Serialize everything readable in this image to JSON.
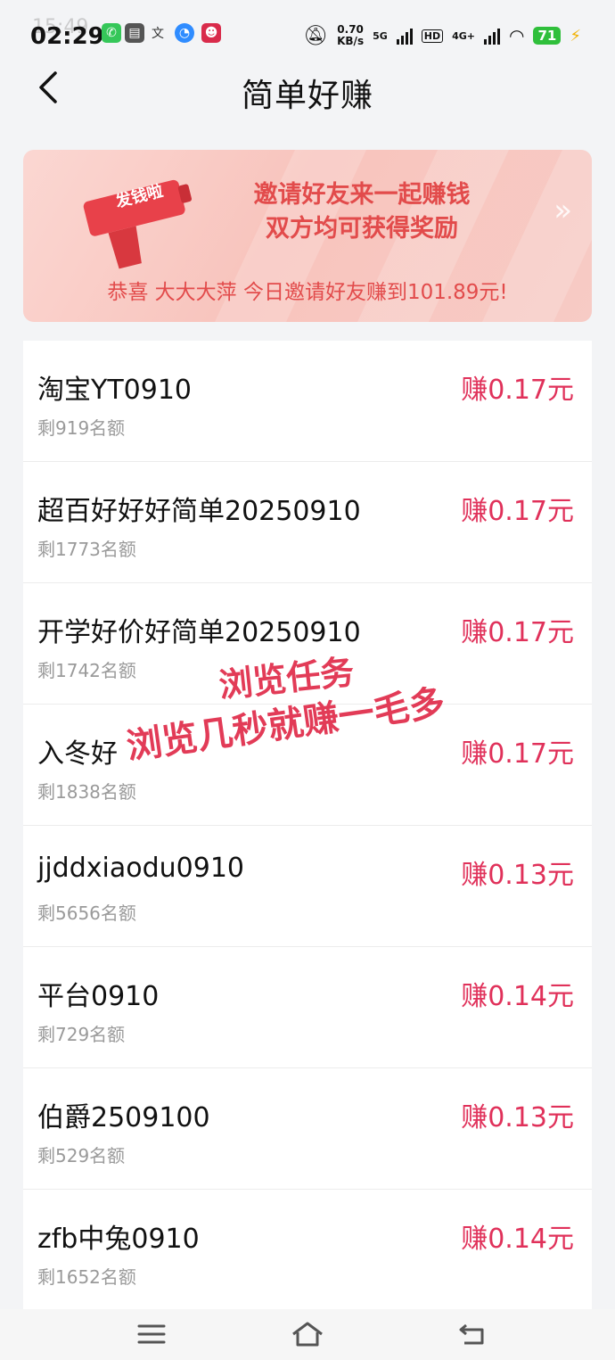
{
  "status_bar": {
    "time": "02:29",
    "time_ghost": "15:49",
    "net_speed": "0.70",
    "net_unit": "KB/s",
    "net_tag_5g": "5G",
    "net_tag_hd": "HD",
    "net_tag_4g": "4G+",
    "battery": "71",
    "icons": [
      "phone-icon",
      "wallet-icon",
      "translate-icon",
      "browser-icon",
      "app-icon",
      "mute-icon",
      "signal-icon",
      "wifi-icon",
      "charging-icon"
    ]
  },
  "header": {
    "back_icon": "back-chevron-icon",
    "title": "简单好赚"
  },
  "banner": {
    "gun_label": "发钱啦",
    "line1": "邀请好友来一起赚钱",
    "line2": "双方均可获得奖励",
    "ticker": "恭喜 大大大萍 今日邀请好友赚到101.89元!",
    "colors": {
      "text": "#e24b4b",
      "bg": "#f8c4bd"
    }
  },
  "tasks": [
    {
      "name": "淘宝YT0910",
      "remain": "剩919名额",
      "reward": "赚0.17元"
    },
    {
      "name": "超百好好好简单20250910",
      "remain": "剩1773名额",
      "reward": "赚0.17元"
    },
    {
      "name": "开学好价好简单20250910",
      "remain": "剩1742名额",
      "reward": "赚0.17元"
    },
    {
      "name": "入冬好",
      "remain": "剩1838名额",
      "reward": "赚0.17元"
    },
    {
      "name": "jjddxiaodu0910",
      "remain": "剩5656名额",
      "reward": "赚0.13元"
    },
    {
      "name": "平台0910",
      "remain": "剩729名额",
      "reward": "赚0.14元"
    },
    {
      "name": "伯爵2509100",
      "remain": "剩529名额",
      "reward": "赚0.13元"
    },
    {
      "name": "zfb中兔0910",
      "remain": "剩1652名额",
      "reward": "赚0.14元"
    }
  ],
  "overlay": {
    "line1": "浏览任务",
    "line2": "浏览几秒就赚一毛多"
  },
  "nav": {
    "icons": [
      "menu-icon",
      "home-icon",
      "return-icon"
    ]
  },
  "colors": {
    "reward": "#e0315a",
    "page_bg": "#f3f4f6"
  }
}
